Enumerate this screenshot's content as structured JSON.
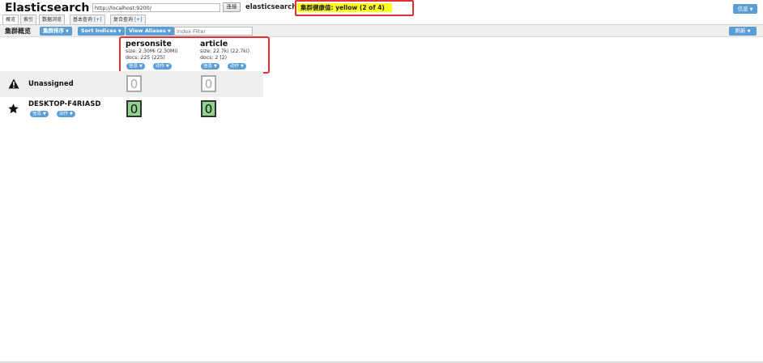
{
  "header": {
    "app_title": "Elasticsearch",
    "url_value": "http://localhost:9200/",
    "connect_label": "连接",
    "cluster_name": "elasticsearch",
    "health_text": "集群健康值: yellow (2 of 4)",
    "health_color": "#ffff20",
    "info_label": "信息"
  },
  "tabs": [
    {
      "label": "概览"
    },
    {
      "label": "索引"
    },
    {
      "label": "数据浏览"
    },
    {
      "label": "基本查询",
      "plus": "[+]"
    },
    {
      "label": "复合查询",
      "plus": "[+]"
    }
  ],
  "toolbar": {
    "title": "集群概览",
    "sort_cluster_label": "集群排序",
    "sort_indices_label": "Sort Indices",
    "view_aliases_label": "View Aliases",
    "filter_placeholder": "Index Filter",
    "refresh_label": "刷新"
  },
  "indices": [
    {
      "name": "personsite",
      "size": "size: 2.30Mi (2.30Mi)",
      "docs": "docs: 225 (225)",
      "info_label": "信息",
      "action_label": "动作"
    },
    {
      "name": "article",
      "size": "size: 22.7ki (22.7ki)",
      "docs": "docs: 2 (2)",
      "info_label": "信息",
      "action_label": "动作"
    }
  ],
  "rows": {
    "unassigned": {
      "label": "Unassigned",
      "shards": [
        "0",
        "0"
      ]
    },
    "node": {
      "label": "DESKTOP-F4RIASD",
      "info_label": "信息",
      "action_label": "动作",
      "shards": [
        "0",
        "0"
      ]
    }
  },
  "colors": {
    "accent": "#5b9ed6",
    "highlight_border": "#e03030",
    "shard_started": "#8fd38f",
    "shard_unassigned": "#aaaaaa"
  },
  "icons": {
    "unassigned": "warning-icon",
    "node": "star-icon"
  }
}
